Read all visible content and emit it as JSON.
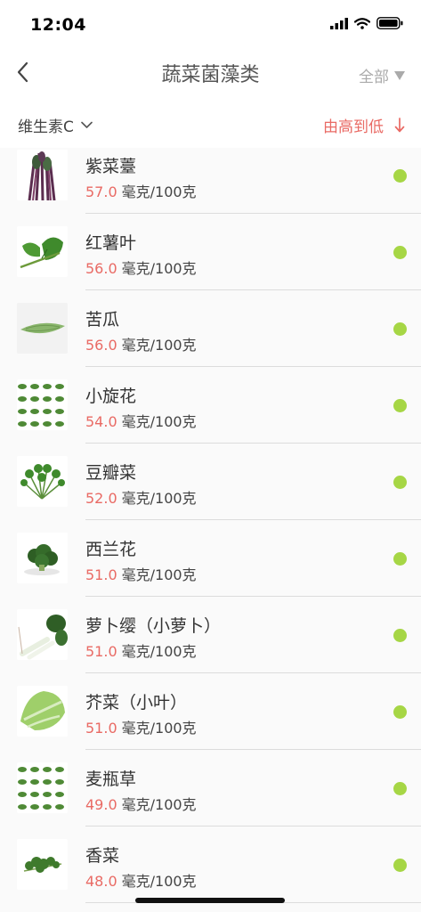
{
  "status_bar": {
    "time": "12:04"
  },
  "nav": {
    "title": "蔬菜菌藻类",
    "filter_label": "全部"
  },
  "sort": {
    "nutrient_label": "维生素C",
    "order_label": "由高到低"
  },
  "colors": {
    "accent": "#e96a64",
    "status_green": "#a6d645"
  },
  "items": [
    {
      "name": "紫菜薹",
      "value": "57.0",
      "unit": "毫克/100克",
      "thumb_icon": "purple-stem-vegetable-icon"
    },
    {
      "name": "红薯叶",
      "value": "56.0",
      "unit": "毫克/100克",
      "thumb_icon": "sweet-potato-leaf-icon"
    },
    {
      "name": "苦瓜",
      "value": "56.0",
      "unit": "毫克/100克",
      "thumb_icon": "bitter-melon-icon"
    },
    {
      "name": "小旋花",
      "value": "54.0",
      "unit": "毫克/100克",
      "thumb_icon": "herb-grid-icon"
    },
    {
      "name": "豆瓣菜",
      "value": "52.0",
      "unit": "毫克/100克",
      "thumb_icon": "watercress-icon"
    },
    {
      "name": "西兰花",
      "value": "51.0",
      "unit": "毫克/100克",
      "thumb_icon": "broccoli-icon"
    },
    {
      "name": "萝卜缨（小萝卜）",
      "value": "51.0",
      "unit": "毫克/100克",
      "thumb_icon": "radish-greens-icon"
    },
    {
      "name": "芥菜（小叶）",
      "value": "51.0",
      "unit": "毫克/100克",
      "thumb_icon": "mustard-greens-icon"
    },
    {
      "name": "麦瓶草",
      "value": "49.0",
      "unit": "毫克/100克",
      "thumb_icon": "herb-grid-icon"
    },
    {
      "name": "香菜",
      "value": "48.0",
      "unit": "毫克/100克",
      "thumb_icon": "coriander-icon"
    }
  ]
}
